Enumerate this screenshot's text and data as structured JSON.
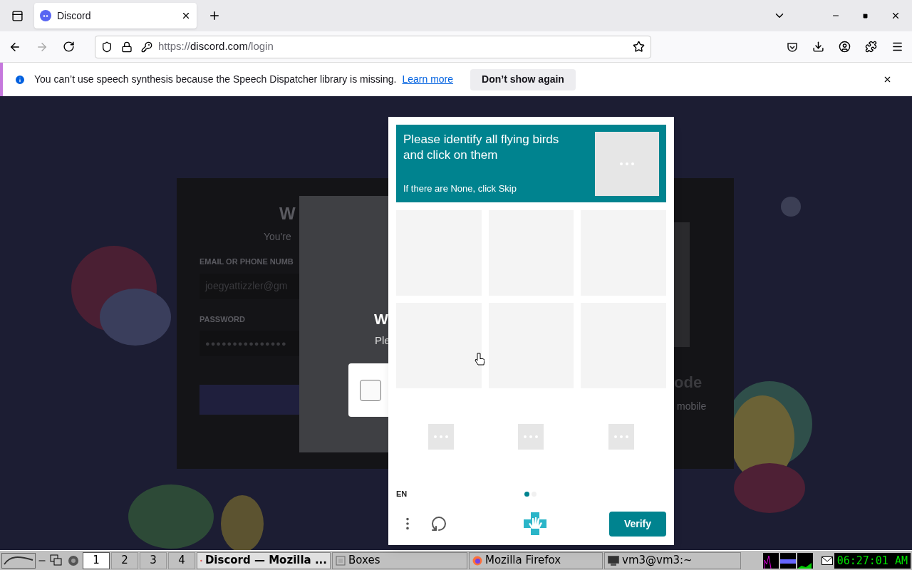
{
  "browser": {
    "tabs": [
      {
        "title": "Discord",
        "selected": true
      }
    ],
    "url": {
      "scheme": "https://",
      "host": "discord.com",
      "path": "/login"
    },
    "notification": {
      "message": "You can’t use speech synthesis because the Speech Dispatcher library is missing.",
      "link": "Learn more",
      "button": "Don’t show again"
    }
  },
  "page": {
    "login": {
      "title": "W",
      "subtitle": "You're",
      "email_label": "EMAIL OR PHONE NUMB",
      "email_value": "joegyattizzler@gm",
      "password_label": "PASSWORD",
      "password_value": "●●●●●●●●●●●●●●●"
    },
    "qr": {
      "title": "ode",
      "subtitle": "mobile"
    },
    "dialog": {
      "title": "W",
      "text": "Ple",
      "checkbox": {
        "checked": false
      }
    }
  },
  "captcha": {
    "prompt": "Please identify all flying birds and click on them",
    "hint": "If there are None, click Skip",
    "tiles": [
      {
        "kind": "blank"
      },
      {
        "kind": "blank"
      },
      {
        "kind": "blank"
      },
      {
        "kind": "blank"
      },
      {
        "kind": "blank"
      },
      {
        "kind": "blank"
      }
    ],
    "samples": [
      {
        "kind": "loading"
      },
      {
        "kind": "loading"
      },
      {
        "kind": "loading"
      }
    ],
    "language": "EN",
    "pages": [
      {
        "selected": true
      },
      {
        "selected": false
      }
    ],
    "verify": "Verify"
  },
  "taskbar": {
    "workspaces": [
      {
        "label": "1",
        "selected": true
      },
      {
        "label": "2",
        "selected": false
      },
      {
        "label": "3",
        "selected": false
      },
      {
        "label": "4",
        "selected": false
      }
    ],
    "tasks": [
      {
        "title": "Discord — Mozilla ...",
        "selected": true,
        "kind": "firefox"
      },
      {
        "title": "Boxes",
        "selected": false,
        "kind": "boxes"
      },
      {
        "title": "Mozilla Firefox",
        "selected": false,
        "kind": "firefox"
      },
      {
        "title": "vm3@vm3:~",
        "selected": false,
        "kind": "terminal"
      }
    ],
    "clock": "06:27:01 AM"
  }
}
